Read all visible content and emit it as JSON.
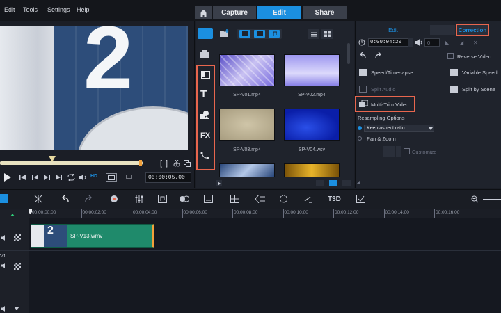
{
  "menu": {
    "edit": "Edit",
    "tools": "Tools",
    "settings": "Settings",
    "help": "Help"
  },
  "tabs": {
    "capture": "Capture",
    "edit": "Edit",
    "share": "Share"
  },
  "preview": {
    "big_digit": "2",
    "timecode": "00:00:05.00",
    "mark_in": "[",
    "mark_out": "]",
    "sd_badge": "HD"
  },
  "library": {
    "items": [
      {
        "label": "SP-V01.mp4"
      },
      {
        "label": "SP-V02.mp4"
      },
      {
        "label": "SP-V03.mp4"
      },
      {
        "label": "SP-V04.wsv"
      },
      {
        "label": ""
      },
      {
        "label": ""
      }
    ],
    "tool_fx": "FX",
    "tool_t": "T"
  },
  "options": {
    "tab_edit": "Edit",
    "tab_correction": "Correction",
    "duration": "0:00:04:20",
    "volume": "0",
    "reverse_video": "Reverse Video",
    "speed_timelapse": "Speed/Time-lapse",
    "variable_speed": "Variable Speed",
    "split_audio": "Split Audio",
    "split_by_scene": "Split by Scene",
    "multi_trim": "Multi-Trim Video",
    "resampling_options": "Resampling Options",
    "resample_select": "Keep aspect ratio",
    "pan_zoom": "Pan & Zoom",
    "customize": "Customize"
  },
  "ruler": {
    "ticks": [
      "00:00:00:00",
      "00:00:02:00",
      "00:00:04:00",
      "00:00:06:00",
      "00:00:08:00",
      "00:00:10:00",
      "00:00:12:00",
      "00:00:14:00",
      "00:00:16:00"
    ]
  },
  "timeline": {
    "clip_label": "SP-V13.wmv",
    "clip_thumb_digit": "2",
    "track2_label": "V1",
    "t3d": "T3D"
  },
  "colors": {
    "accent": "#1b8fe0",
    "highlight": "#e8664e",
    "clip": "#1f8a6b"
  }
}
